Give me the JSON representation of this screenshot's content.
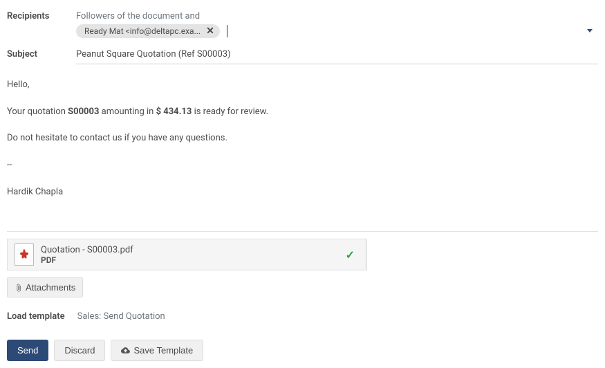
{
  "labels": {
    "recipients": "Recipients",
    "subject": "Subject",
    "attachments": "Attachments",
    "load_template": "Load template"
  },
  "recipients": {
    "followers_text": "Followers of the document and",
    "chips": [
      {
        "display": "Ready Mat <info@deltapc.exa..."
      }
    ]
  },
  "subject": "Peanut Square Quotation (Ref S00003)",
  "body": {
    "greeting": "Hello,",
    "line1_pre": "Your quotation ",
    "line1_ref": "S00003",
    "line1_mid": " amounting in ",
    "line1_amount": "$ 434.13",
    "line1_post": " is ready for review.",
    "line2": "Do not hesitate to contact us if you have any questions.",
    "sig_divider": "--",
    "signature": "Hardik Chapla"
  },
  "attachment": {
    "filename": "Quotation - S00003.pdf",
    "type": "PDF"
  },
  "template": {
    "value": "Sales: Send Quotation"
  },
  "buttons": {
    "send": "Send",
    "discard": "Discard",
    "save_template": "Save Template"
  }
}
